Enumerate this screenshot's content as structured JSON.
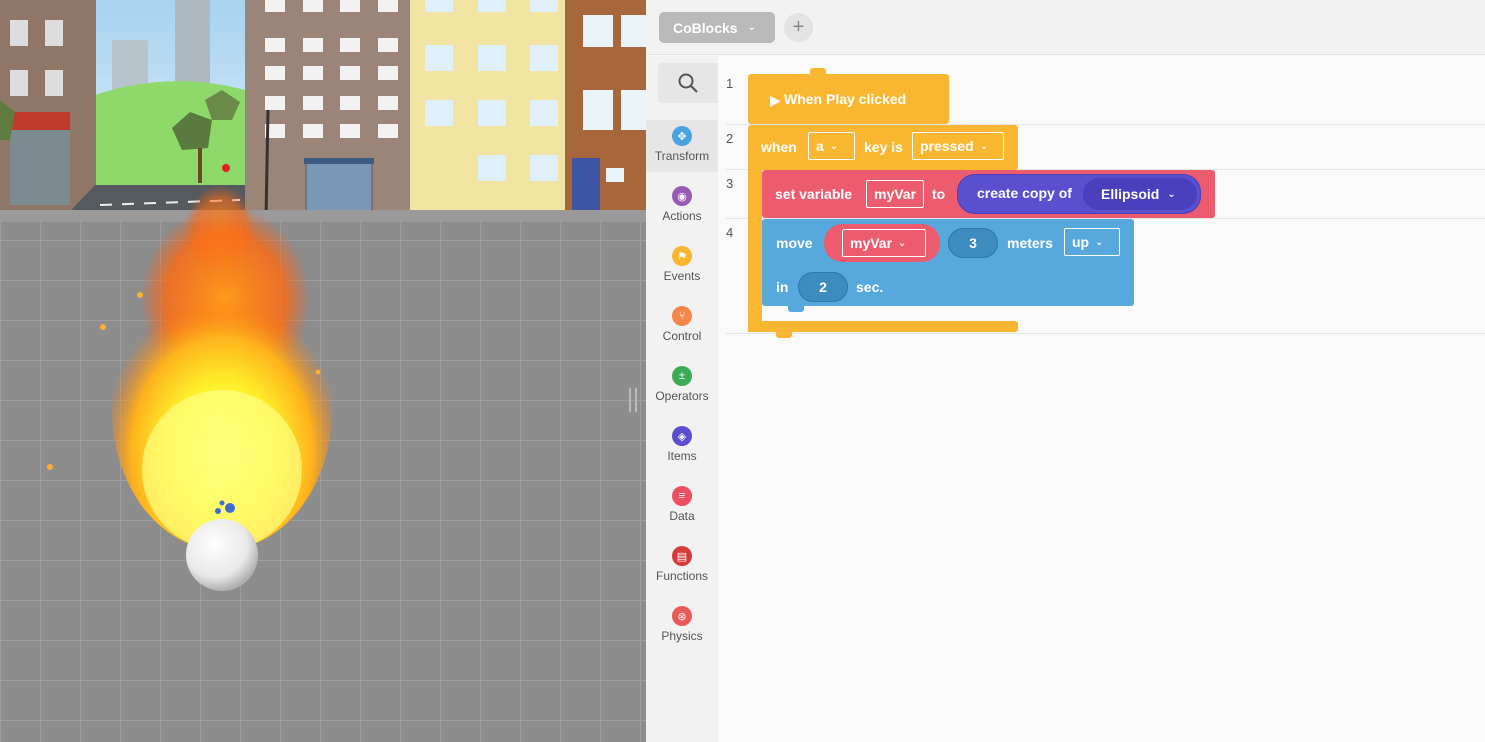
{
  "editor": {
    "tab_label": "CoBlocks",
    "add_tab_symbol": "+",
    "categories": [
      {
        "label": "Transform",
        "color": "#4aa3df",
        "icon": "move-arrows-icon"
      },
      {
        "label": "Actions",
        "color": "#9b59b6",
        "icon": "eye-icon"
      },
      {
        "label": "Events",
        "color": "#f9b630",
        "icon": "flag-icon"
      },
      {
        "label": "Control",
        "color": "#f4864a",
        "icon": "branch-icon"
      },
      {
        "label": "Operators",
        "color": "#3daa56",
        "icon": "plus-percent-icon"
      },
      {
        "label": "Items",
        "color": "#5a4fcf",
        "icon": "cube-icon"
      },
      {
        "label": "Data",
        "color": "#ec4e62",
        "icon": "list-icon"
      },
      {
        "label": "Functions",
        "color": "#d63a3a",
        "icon": "book-icon"
      },
      {
        "label": "Physics",
        "color": "#e85a5a",
        "icon": "orbit-icon"
      }
    ],
    "line_numbers": [
      "1",
      "2",
      "3",
      "4"
    ]
  },
  "blocks": {
    "event_label": "When Play clicked",
    "when_label": "when",
    "key_value": "a",
    "key_is_label": "key is",
    "key_state": "pressed",
    "set_variable_label": "set variable",
    "var_name": "myVar",
    "to_label": "to",
    "create_copy_label": "create copy of",
    "copy_target": "Ellipsoid",
    "move_label": "move",
    "move_var": "myVar",
    "move_amount": "3",
    "meters_label": "meters",
    "direction": "up",
    "in_label": "in",
    "duration": "2",
    "sec_label": "sec."
  },
  "colors": {
    "event": "#f9b630",
    "data": "#ec5b6e",
    "items": "#5a4fcf",
    "transform": "#57a8dd"
  }
}
